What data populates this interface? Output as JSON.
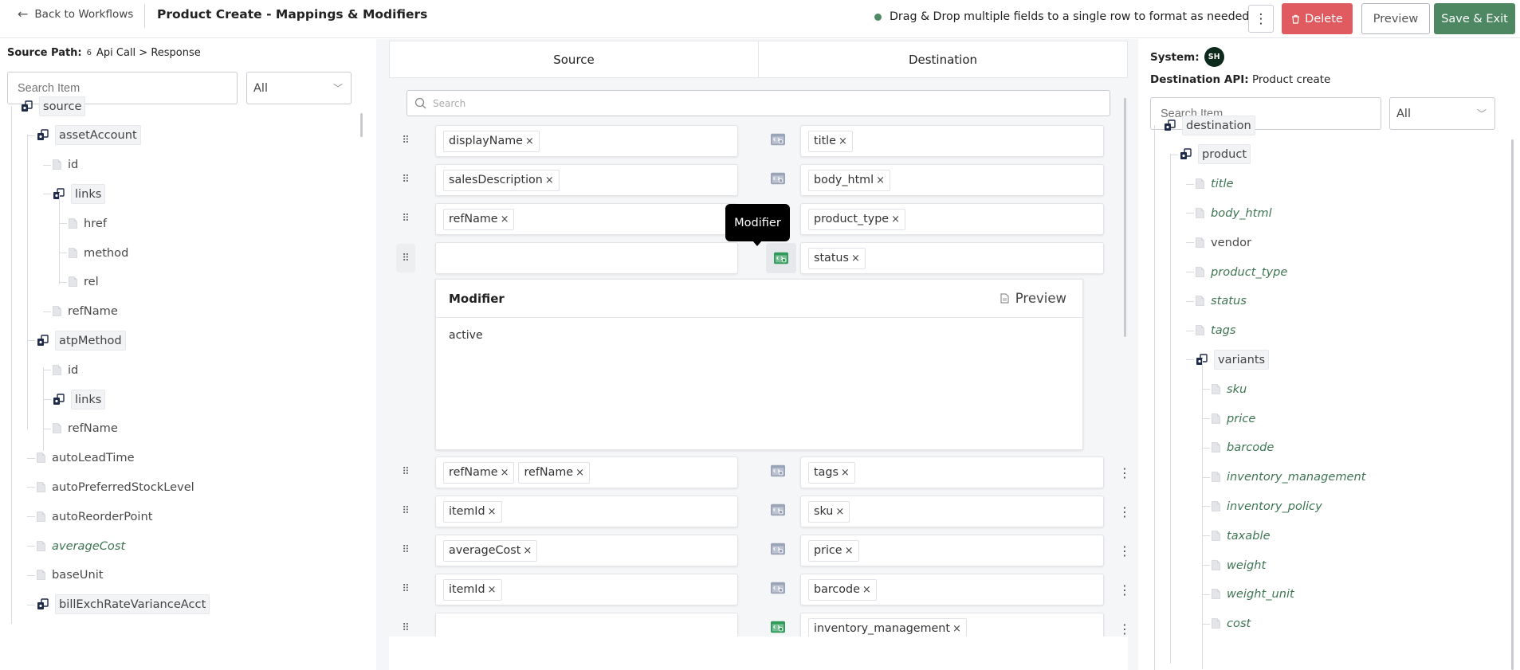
{
  "header": {
    "back_label": "Back to Workflows",
    "title": "Product Create - Mappings & Modifiers",
    "hint": "Drag & Drop multiple fields to a single row to format as needed",
    "delete_label": "Delete",
    "preview_label": "Preview",
    "save_label": "Save & Exit",
    "accent_color": "#4d8862",
    "danger_color": "#df5b5f"
  },
  "left": {
    "source_path_label": "Source Path:",
    "source_path_count": "6",
    "source_path_value": "Api Call > Response",
    "search_placeholder": "Search Item",
    "filter_value": "All",
    "tree": [
      {
        "label": "source",
        "kind": "object"
      },
      {
        "label": "assetAccount",
        "kind": "object"
      },
      {
        "label": "id",
        "kind": "field"
      },
      {
        "label": "links",
        "kind": "object"
      },
      {
        "label": "href",
        "kind": "field"
      },
      {
        "label": "method",
        "kind": "field"
      },
      {
        "label": "rel",
        "kind": "field"
      },
      {
        "label": "refName",
        "kind": "field"
      },
      {
        "label": "atpMethod",
        "kind": "object"
      },
      {
        "label": "id",
        "kind": "field"
      },
      {
        "label": "links",
        "kind": "object"
      },
      {
        "label": "refName",
        "kind": "field"
      },
      {
        "label": "autoLeadTime",
        "kind": "field"
      },
      {
        "label": "autoPreferredStockLevel",
        "kind": "field"
      },
      {
        "label": "autoReorderPoint",
        "kind": "field"
      },
      {
        "label": "averageCost",
        "kind": "field",
        "mapped": true
      },
      {
        "label": "baseUnit",
        "kind": "field"
      },
      {
        "label": "billExchRateVarianceAcct",
        "kind": "object"
      }
    ]
  },
  "middle": {
    "tab_source": "Source",
    "tab_destination": "Destination",
    "search_placeholder": "Search",
    "tooltip": "Modifier",
    "modifier": {
      "title": "Modifier",
      "preview_label": "Preview",
      "value": "active"
    },
    "rows": [
      {
        "source": [
          "displayName"
        ],
        "destination": [
          "title"
        ],
        "has_modifier": false
      },
      {
        "source": [
          "salesDescription"
        ],
        "destination": [
          "body_html"
        ],
        "has_modifier": false
      },
      {
        "source": [
          "refName"
        ],
        "destination": [
          "product_type"
        ],
        "has_modifier": false
      },
      {
        "source": [],
        "destination": [
          "status"
        ],
        "has_modifier": true
      },
      {
        "source": [
          "refName",
          "refName"
        ],
        "destination": [
          "tags"
        ],
        "has_modifier": false
      },
      {
        "source": [
          "itemId"
        ],
        "destination": [
          "sku"
        ],
        "has_modifier": false
      },
      {
        "source": [
          "averageCost"
        ],
        "destination": [
          "price"
        ],
        "has_modifier": false
      },
      {
        "source": [
          "itemId"
        ],
        "destination": [
          "barcode"
        ],
        "has_modifier": false
      },
      {
        "source": [],
        "destination": [
          "inventory_management"
        ],
        "has_modifier": true
      }
    ],
    "chip_remove": "×"
  },
  "right": {
    "system_label": "System:",
    "system_avatar": "SH",
    "dest_api_label": "Destination API:",
    "dest_api_value": "Product create",
    "search_placeholder": "Search Item",
    "filter_value": "All",
    "tree": [
      {
        "label": "destination",
        "kind": "object"
      },
      {
        "label": "product",
        "kind": "object"
      },
      {
        "label": "title",
        "kind": "field",
        "mapped": true
      },
      {
        "label": "body_html",
        "kind": "field",
        "mapped": true
      },
      {
        "label": "vendor",
        "kind": "field"
      },
      {
        "label": "product_type",
        "kind": "field",
        "mapped": true
      },
      {
        "label": "status",
        "kind": "field",
        "mapped": true
      },
      {
        "label": "tags",
        "kind": "field",
        "mapped": true
      },
      {
        "label": "variants",
        "kind": "object"
      },
      {
        "label": "sku",
        "kind": "field",
        "mapped": true
      },
      {
        "label": "price",
        "kind": "field",
        "mapped": true
      },
      {
        "label": "barcode",
        "kind": "field",
        "mapped": true
      },
      {
        "label": "inventory_management",
        "kind": "field",
        "mapped": true
      },
      {
        "label": "inventory_policy",
        "kind": "field",
        "mapped": true
      },
      {
        "label": "taxable",
        "kind": "field",
        "mapped": true
      },
      {
        "label": "weight",
        "kind": "field",
        "mapped": true
      },
      {
        "label": "weight_unit",
        "kind": "field",
        "mapped": true
      },
      {
        "label": "cost",
        "kind": "field",
        "mapped": true
      }
    ]
  }
}
